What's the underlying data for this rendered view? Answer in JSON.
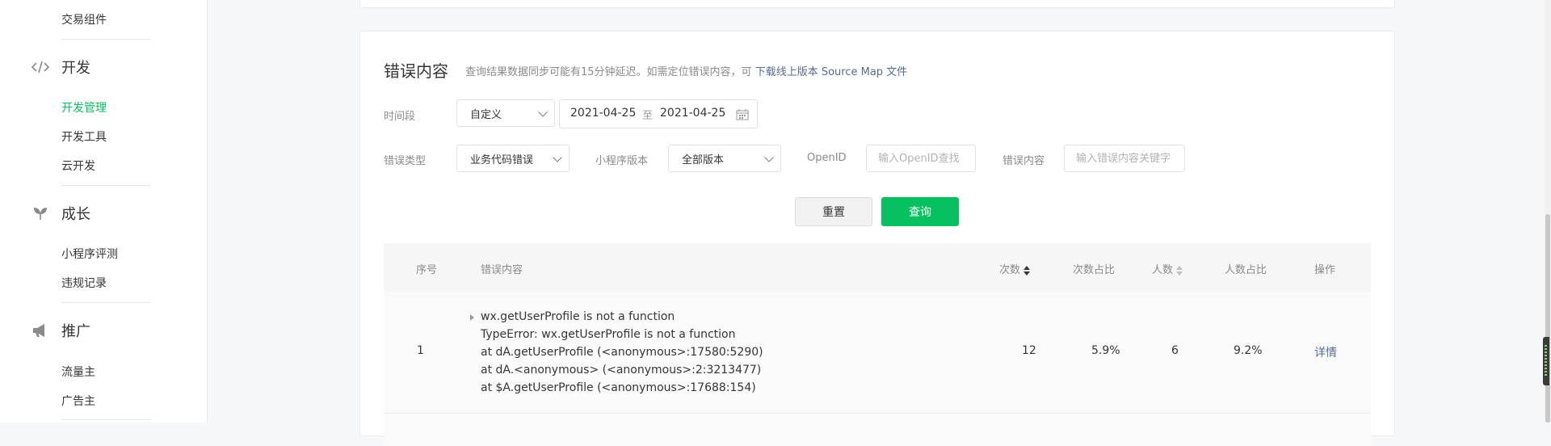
{
  "sidebar": {
    "top_item": "交易组件",
    "groups": [
      {
        "title": "开发",
        "icon": "code-icon",
        "items": [
          "开发管理",
          "开发工具",
          "云开发"
        ]
      },
      {
        "title": "成长",
        "icon": "sprout-icon",
        "items": [
          "小程序评测",
          "违规记录"
        ]
      },
      {
        "title": "推广",
        "icon": "megaphone-icon",
        "items": [
          "流量主",
          "广告主"
        ]
      }
    ],
    "active_item": "开发管理"
  },
  "panel": {
    "title": "错误内容",
    "desc": "查询结果数据同步可能有15分钟延迟。如需定位错误内容，可",
    "desc_link": "下载线上版本 Source Map 文件"
  },
  "filters": {
    "time_label": "时间段",
    "time_select": "自定义",
    "date_start": "2021-04-25",
    "date_sep": "至",
    "date_end": "2021-04-25",
    "error_type_label": "错误类型",
    "error_type_value": "业务代码错误",
    "version_label": "小程序版本",
    "version_value": "全部版本",
    "openid_label": "OpenID",
    "openid_placeholder": "输入OpenID查找",
    "content_label": "错误内容",
    "content_placeholder": "输入错误内容关键字"
  },
  "buttons": {
    "reset": "重置",
    "query": "查询"
  },
  "table": {
    "headers": {
      "index": "序号",
      "content": "错误内容",
      "count": "次数",
      "count_ratio": "次数占比",
      "users": "人数",
      "users_ratio": "人数占比",
      "action": "操作"
    },
    "rows": [
      {
        "index": "1",
        "lines": [
          "wx.getUserProfile is not a function",
          "TypeError: wx.getUserProfile is not a function",
          "at dA.getUserProfile (<anonymous>:17580:5290)",
          "at dA.<anonymous> (<anonymous>:2:3213477)",
          "at $A.getUserProfile (<anonymous>:17688:154)"
        ],
        "count": "12",
        "count_ratio": "5.9%",
        "users": "6",
        "users_ratio": "9.2%",
        "action": "详情"
      }
    ]
  },
  "colors": {
    "accent": "#07c160",
    "link": "#576b95"
  }
}
